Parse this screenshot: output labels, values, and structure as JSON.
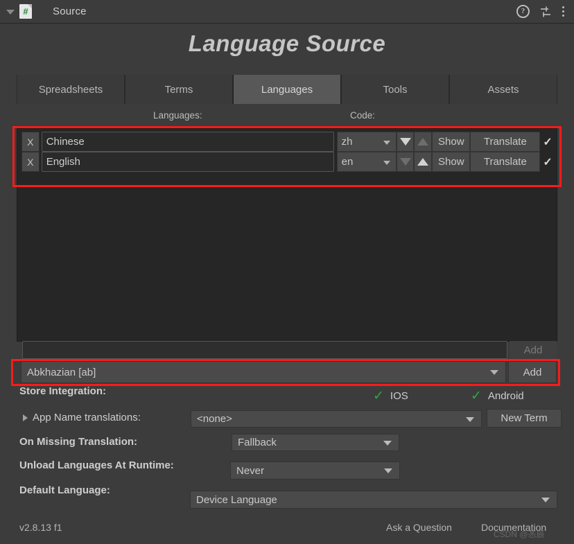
{
  "window": {
    "title": "Source",
    "foldout_icon": "triangle-down-icon",
    "script_icon_glyph": "#",
    "help_icon": "help-icon",
    "help_glyph": "?",
    "preset_icon": "preset-settings-icon",
    "menu_icon": "kebab-menu-icon"
  },
  "page": {
    "title": "Language Source"
  },
  "tabs": [
    {
      "label": "Spreadsheets",
      "active": false
    },
    {
      "label": "Terms",
      "active": false
    },
    {
      "label": "Languages",
      "active": true
    },
    {
      "label": "Tools",
      "active": false
    },
    {
      "label": "Assets",
      "active": false
    }
  ],
  "columns": {
    "languages": "Languages:",
    "code": "Code:"
  },
  "language_rows": [
    {
      "remove_label": "X",
      "name": "Chinese",
      "code": "zh",
      "move_down_enabled": true,
      "move_up_enabled": false,
      "show_label": "Show",
      "translate_label": "Translate",
      "enabled_mark": "✓"
    },
    {
      "remove_label": "X",
      "name": "English",
      "code": "en",
      "move_down_enabled": false,
      "move_up_enabled": true,
      "show_label": "Show",
      "translate_label": "Translate",
      "enabled_mark": "✓"
    }
  ],
  "add_custom": {
    "field_value": "",
    "field_placeholder": "",
    "add_label": "Add"
  },
  "add_language": {
    "selected": "Abkhazian [ab]",
    "add_label": "Add"
  },
  "settings": {
    "store_integration_label": "Store Integration:",
    "store_targets": [
      {
        "name": "IOS",
        "mark": "✓",
        "color": "#2fa83f"
      },
      {
        "name": "Android",
        "mark": "✓",
        "color": "#2fa83f"
      }
    ],
    "app_name_label": "App Name translations:",
    "app_name_value": "<none>",
    "new_term_label": "New Term",
    "missing_label": "On Missing Translation:",
    "missing_value": "Fallback",
    "unload_label": "Unload Languages At Runtime:",
    "unload_value": "Never",
    "default_label": "Default Language:",
    "default_value": "Device Language"
  },
  "footer": {
    "version": "v2.8.13 f1",
    "ask": "Ask a Question",
    "documentation": "Documentation",
    "watermark": "CSDN @忞辰"
  },
  "colors": {
    "window_bg": "#3c3c3c",
    "panel_bg": "#262626",
    "tab_active": "#585858",
    "accent_green": "#2fa83f",
    "annotation_red": "#fb1b1b"
  }
}
